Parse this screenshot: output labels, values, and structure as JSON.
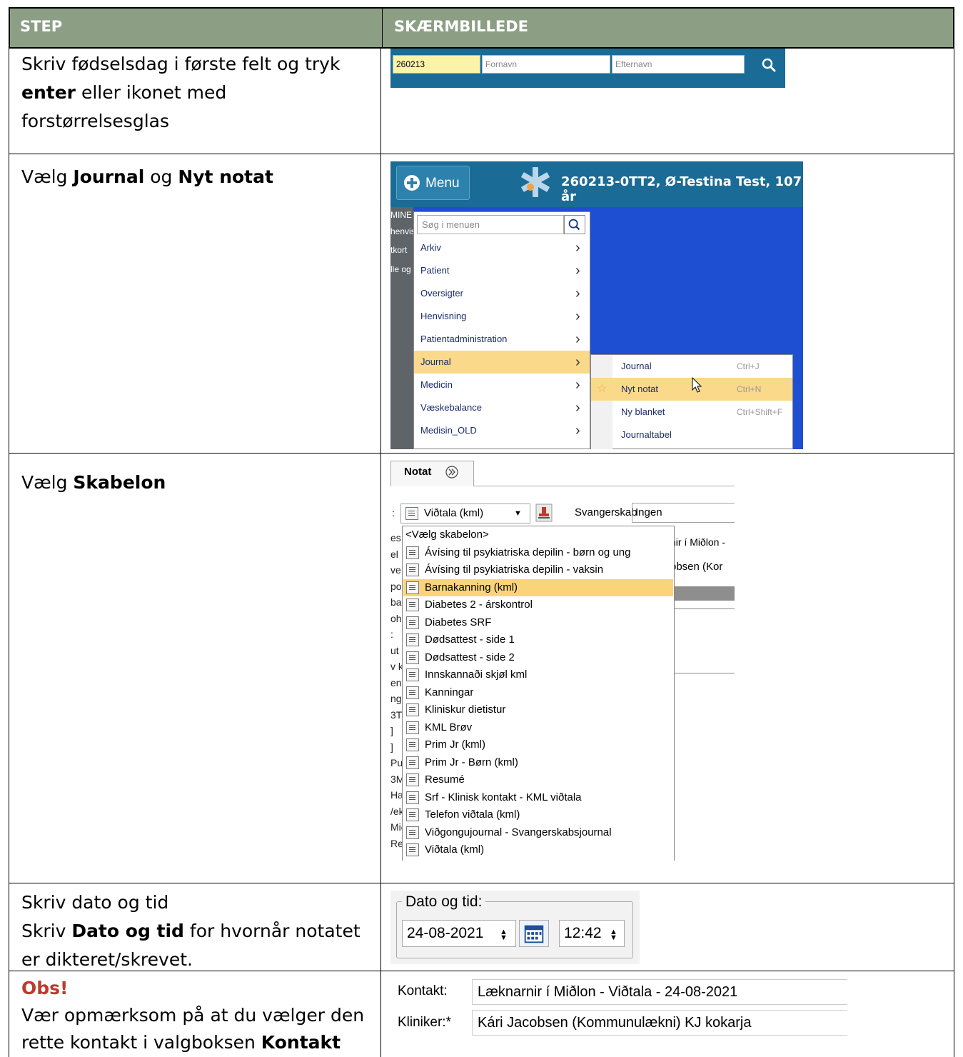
{
  "header": {
    "col1": "STEP",
    "col2": "SKÆRMBILLEDE"
  },
  "steps": [
    {
      "pre": "Skriv fødselsdag i første felt og tryk ",
      "bold": "enter",
      "post": " eller ikonet med forstørrelsesglas"
    },
    {
      "pre": "Vælg ",
      "bold1": "Journal",
      "mid": " og ",
      "bold2": "Nyt notat"
    },
    {
      "pre": "Vælg ",
      "bold": "Skabelon"
    },
    {
      "line1": "Skriv dato og tid",
      "pre": "Skriv ",
      "bold": "Dato og tid",
      "post": " for hvornår notatet er dikteret/skrevet."
    },
    {
      "obs": "Obs!",
      "pre": "Vær opmærksom på at du vælger den rette kontakt i valgboksen ",
      "bold": "Kontakt"
    }
  ],
  "search": {
    "birth": "260213",
    "first_placeholder": "Fornavn",
    "last_placeholder": "Efternavn",
    "accent": "#1a6b96"
  },
  "menu": {
    "button": "Menu",
    "patient": "260213-0TT2,  Ø-Testina Test,  107 år",
    "left_strip": [
      "MINE",
      "henvis",
      "tkort",
      "lle og"
    ],
    "search_placeholder": "Søg i menuen",
    "items": [
      "Arkiv",
      "Patient",
      "Oversigter",
      "Henvisning",
      "Patientadministration",
      "Journal",
      "Medicin",
      "Væskebalance",
      "Medisin_OLD"
    ],
    "highlight_index": 5,
    "submenu": [
      {
        "label": "Journal",
        "shortcut": "Ctrl+J"
      },
      {
        "label": "Nyt notat",
        "shortcut": "Ctrl+N"
      },
      {
        "label": "Ny blanket",
        "shortcut": "Ctrl+Shift+F"
      },
      {
        "label": "Journaltabel",
        "shortcut": ""
      }
    ],
    "sub_highlight_index": 1
  },
  "template": {
    "tab": "Notat",
    "combo_value": "Viðtala (kml)",
    "svangerskab_label": "Svangerskab",
    "svangerskab_value": "Ingen",
    "right_text1": "nir í Miðlon -",
    "right_text2": "obsen (Kor",
    "left_fragments": [
      "es",
      "el",
      "ve",
      "po",
      "ba",
      "oh",
      ":",
      "ut",
      "v k",
      "en",
      "ng",
      "3T",
      "]",
      "]",
      "Pul",
      "3M",
      "Hæ",
      "/ek",
      "Mið",
      "Re"
    ],
    "items": [
      "<Vælg skabelon>",
      "Ávísing til psykiatriska depilin - børn og ung",
      "Ávísing til psykiatriska depilin - vaksin",
      "Barnakanning (kml)",
      "Diabetes 2 - árskontrol",
      "Diabetes SRF",
      "Dødsattest - side 1",
      "Dødsattest - side 2",
      "Innskannaði skjøl kml",
      "Kanningar",
      "Kliniskur dietistur",
      "KML Brøv",
      "Prim Jr (kml)",
      "Prim Jr - Børn (kml)",
      "Resumé",
      "Srf - Klinisk kontakt - KML viðtala",
      "Telefon viðtala (kml)",
      "Viðgongujournal - Svangerskabsjournal",
      "Viðtala (kml)"
    ],
    "highlight_index": 3
  },
  "datetime": {
    "legend": "Dato og tid:",
    "date": "24-08-2021",
    "time": "12:42"
  },
  "contact": {
    "kontakt_label": "Kontakt:",
    "kontakt_value": "Læknarnir í Miðlon - Viðtala -  24-08-2021",
    "kliniker_label": "Kliniker:*",
    "kliniker_value": "Kári Jacobsen (Kommunulækni) KJ kokarja"
  }
}
